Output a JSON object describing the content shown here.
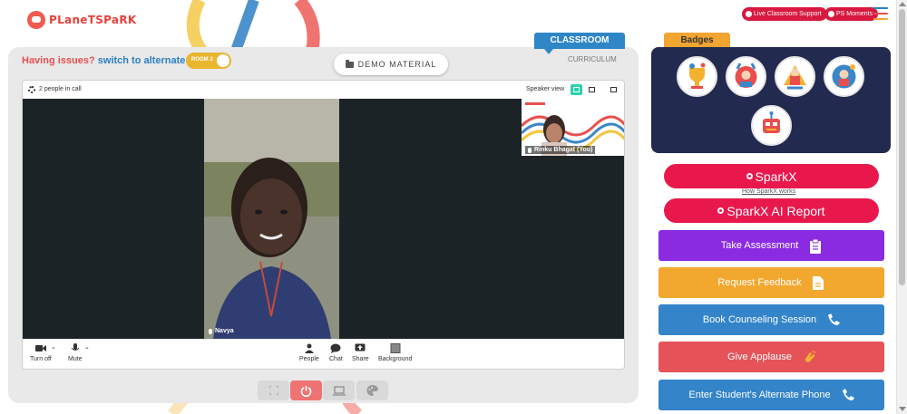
{
  "header": {
    "logo_text": "PLaneTSPaRK",
    "live_support_label": "Live Classroom Support",
    "ps_moments_label": "PS Moments",
    "menu_colors": [
      "#2b7fc2",
      "#e94e4e",
      "#f2a531"
    ]
  },
  "main": {
    "issue_prefix": "Having issues?",
    "issue_link": "switch to alternate room",
    "room_toggle_label": "ROOM 2",
    "demo_material_label": "DEMO MATERIAL",
    "classroom_tab": "CLASSROOM",
    "curriculum_label": "CURRICULUM"
  },
  "call": {
    "people_count": "2 people in call",
    "speaker_view_label": "Speaker view",
    "main_participant": "Navya",
    "self_participant": "Rinku Bhagat (You)",
    "controls": {
      "turn_off": "Turn off",
      "mute": "Mute",
      "people": "People",
      "chat": "Chat",
      "share": "Share",
      "background": "Background"
    }
  },
  "sidebar": {
    "badges_title": "Badges",
    "sparkx_label": "SparkX",
    "sparkx_link": "How SparkX works",
    "sparkx_report_label": "SparkX AI Report",
    "actions": [
      {
        "label": "Take Assessment",
        "color": "#8a2be2",
        "icon": "clipboard-icon"
      },
      {
        "label": "Request Feedback",
        "color": "#f2a82e",
        "icon": "document-icon"
      },
      {
        "label": "Book Counseling Session",
        "color": "#3384c9",
        "icon": "phone-icon"
      },
      {
        "label": "Give Applause",
        "color": "#e55359",
        "icon": "clap-icon"
      },
      {
        "label": "Enter Student's Alternate Phone",
        "color": "#3384c9",
        "icon": "phone-icon"
      }
    ]
  },
  "colors": {
    "accent_red": "#e8184d",
    "classroom_blue": "#2f86c6",
    "badges_orange": "#f2a531",
    "badges_panel": "#232a4f"
  }
}
